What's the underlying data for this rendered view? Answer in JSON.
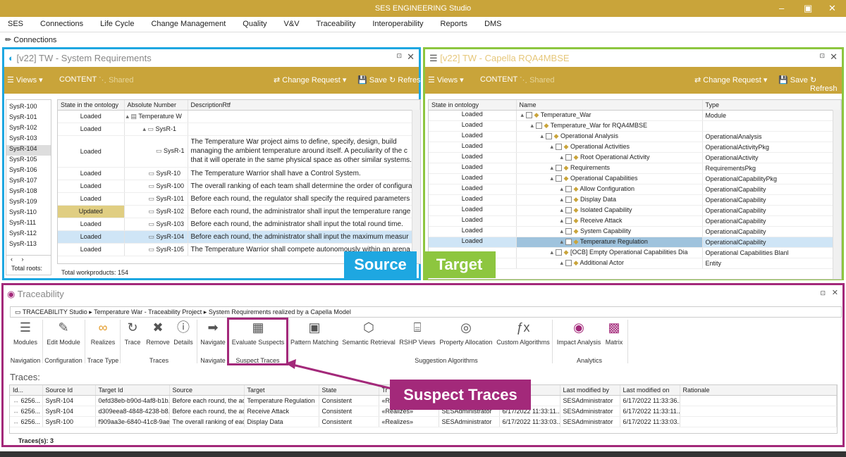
{
  "window": {
    "title": "SES ENGINEERING Studio"
  },
  "menu": [
    "SES",
    "Connections",
    "Life Cycle",
    "Change Management",
    "Quality",
    "V&V",
    "Traceability",
    "Interoperability",
    "Reports",
    "DMS"
  ],
  "connections_label": "Connections",
  "left": {
    "title": "[v22] TW - System Requirements",
    "toolbar": {
      "views": "Views",
      "content": "CONTENT",
      "shared": "Shared",
      "change_request": "Change Request",
      "save": "Save",
      "refresh": "Refresh"
    },
    "ids": [
      "SysR-100",
      "SysR-101",
      "SysR-102",
      "SysR-103",
      "SysR-104",
      "SysR-105",
      "SysR-106",
      "SysR-107",
      "SysR-108",
      "SysR-109",
      "SysR-110",
      "SysR-111",
      "SysR-112",
      "SysR-113"
    ],
    "total_roots": "Total roots:",
    "columns": [
      "State in the ontology",
      "Absolute Number",
      "DescriptionRtf"
    ],
    "rows": [
      {
        "state": "Loaded",
        "num": "Temperature W",
        "desc": ""
      },
      {
        "state": "Loaded",
        "num": "SysR-1",
        "desc": ""
      },
      {
        "state": "Loaded",
        "num": "SysR-1",
        "desc": "The Temperature War project aims to define, specify, design, build",
        "desc2": "managing the ambient temperature around itself. A peculiarity of the c",
        "desc3": "that it will operate in the same physical space as other similar systems."
      },
      {
        "state": "Loaded",
        "num": "SysR-10",
        "desc": "The Temperature Warrior shall have a Control System."
      },
      {
        "state": "Loaded",
        "num": "SysR-100",
        "desc": "The overall ranking of each team shall determine the order of configura"
      },
      {
        "state": "Loaded",
        "num": "SysR-101",
        "desc": "Before each round, the regulator shall specify the required parameters"
      },
      {
        "state": "Updated",
        "num": "SysR-102",
        "desc": "Before each round, the administrator shall input the temperature range"
      },
      {
        "state": "Loaded",
        "num": "SysR-103",
        "desc": "Before each round, the administrator shall input the total round time."
      },
      {
        "state": "Loaded",
        "num": "SysR-104",
        "desc": "Before each round, the administrator shall input the maximum measur"
      },
      {
        "state": "Loaded",
        "num": "SysR-105",
        "desc": "The Temperature Warrior shall compete autonomously within an arena"
      }
    ],
    "total": "Total workproducts: 154",
    "badge": "Source"
  },
  "right": {
    "title": "[v22] TW - Capella RQA4MBSE",
    "columns": [
      "State in ontology",
      "Name",
      "Type"
    ],
    "rows": [
      {
        "state": "Loaded",
        "name": "Temperature_War",
        "type": "Module"
      },
      {
        "state": "Loaded",
        "name": "Temperature_War for RQA4MBSE",
        "type": ""
      },
      {
        "state": "Loaded",
        "name": "Operational Analysis",
        "type": "OperationalAnalysis"
      },
      {
        "state": "Loaded",
        "name": "Operational Activities",
        "type": "OperationalActivityPkg"
      },
      {
        "state": "Loaded",
        "name": "Root Operational Activity",
        "type": "OperationalActivity"
      },
      {
        "state": "Loaded",
        "name": "Requirements",
        "type": "RequirementsPkg"
      },
      {
        "state": "Loaded",
        "name": "Operational Capabilities",
        "type": "OperationalCapabilityPkg"
      },
      {
        "state": "Loaded",
        "name": "Allow Configuration",
        "type": "OperationalCapability"
      },
      {
        "state": "Loaded",
        "name": "Display Data",
        "type": "OperationalCapability"
      },
      {
        "state": "Loaded",
        "name": "Isolated Capability",
        "type": "OperationalCapability"
      },
      {
        "state": "Loaded",
        "name": "Receive Attack",
        "type": "OperationalCapability"
      },
      {
        "state": "Loaded",
        "name": "System Capability",
        "type": "OperationalCapability"
      },
      {
        "state": "Loaded",
        "name": "Temperature Regulation",
        "type": "OperationalCapability"
      },
      {
        "state": "",
        "name": "[OCB] Empty Operational Capabilities Dia",
        "type": "Operational Capabilities Blanl"
      },
      {
        "state": "",
        "name": "Additional Actor",
        "type": "Entity"
      }
    ],
    "badge": "Target"
  },
  "trace": {
    "title": "Traceability",
    "breadcrumb": [
      "TRACEABILITY Studio",
      "Temperature War - Traceability Project",
      "System Requirements realized by a Capella Model"
    ],
    "buttons": [
      "Modules",
      "Edit Module",
      "Realizes",
      "Trace",
      "Remove",
      "Details",
      "Navigate",
      "Evaluate Suspects",
      "Pattern Matching",
      "Semantic Retrieval",
      "RSHP Views",
      "Property Allocation",
      "Custom Algorithms",
      "Impact Analysis",
      "Matrix"
    ],
    "groups": [
      "Navigation",
      "Configuration",
      "Trace Type",
      "Traces",
      "Navigate",
      "Suspect Traces",
      "Suggestion Algorithms",
      "Analytics"
    ],
    "traces_label": "Traces:",
    "columns": [
      "Id...",
      "Source Id",
      "Target Id",
      "Source",
      "Target",
      "State",
      "Tr",
      "",
      "",
      "Last modified by",
      "Last modified on",
      "Rationale"
    ],
    "rows": [
      [
        "6256...",
        "SysR-104",
        "0efd38eb-b90d-4af8-b1b...",
        "Before each round, the ad...",
        "Temperature Regulation",
        "Consistent",
        "«R",
        "",
        "",
        "SESAdministrator",
        "6/17/2022 11:33:36..."
      ],
      [
        "6256...",
        "SysR-104",
        "d309eea8-4848-4238-b8...",
        "Before each round, the ad...",
        "Receive Attack",
        "Consistent",
        "«Realizes»",
        "SESAdministrator",
        "6/17/2022 11:33:11...",
        "SESAdministrator",
        "6/17/2022 11:33:11..."
      ],
      [
        "6256...",
        "SysR-100",
        "f909aa3e-6840-41c8-9ae...",
        "The overall ranking of eac...",
        "Display Data",
        "Consistent",
        "«Realizes»",
        "SESAdministrator",
        "6/17/2022 11:33:03...",
        "SESAdministrator",
        "6/17/2022 11:33:03..."
      ]
    ],
    "count": "Traces(s): 3",
    "callout": "Suspect Traces"
  },
  "colors": {
    "gold": "#c9a43a",
    "blue": "#1ea7e1",
    "green": "#8dc63f",
    "magenta": "#a3297a"
  }
}
